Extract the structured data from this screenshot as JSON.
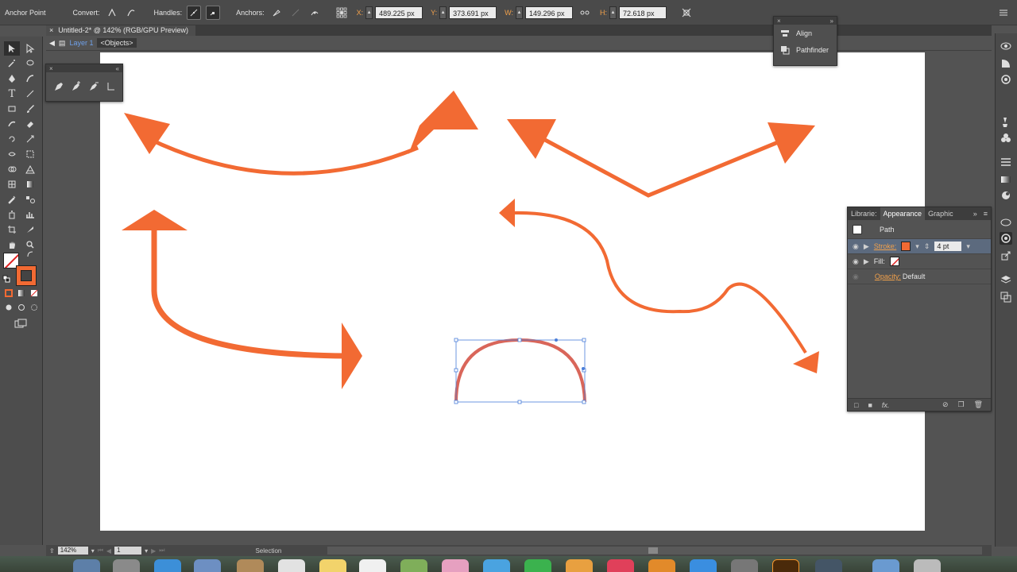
{
  "control_bar": {
    "tool_name": "Anchor Point",
    "convert_label": "Convert:",
    "handles_label": "Handles:",
    "anchors_label": "Anchors:",
    "x_label": "X:",
    "x_value": "489.225 px",
    "y_label": "Y:",
    "y_value": "373.691 px",
    "w_label": "W:",
    "w_value": "149.296 px",
    "h_label": "H:",
    "h_value": "72.618 px"
  },
  "document": {
    "tab_title": "Untitled-2* @ 142% (RGB/GPU Preview)",
    "close_glyph": "×",
    "layer_name": "Layer 1",
    "object_label": "<Objects>"
  },
  "floating_panels": {
    "align_label": "Align",
    "pathfinder_label": "Pathfinder"
  },
  "appearance_panel": {
    "tabs": [
      "Librarie:",
      "Appearance",
      "Graphic"
    ],
    "object_type": "Path",
    "stroke_label": "Stroke:",
    "stroke_weight": "4 pt",
    "fill_label": "Fill:",
    "opacity_label": "Opacity:",
    "opacity_value": "Default",
    "fx_label": "fx."
  },
  "status_bar": {
    "zoom": "142%",
    "artboard_number": "1",
    "current_tool": "Selection"
  },
  "colors": {
    "stroke_orange": "#f26a33",
    "accent_orange": "#f0a04b",
    "selection_blue": "#4a7ed9"
  }
}
